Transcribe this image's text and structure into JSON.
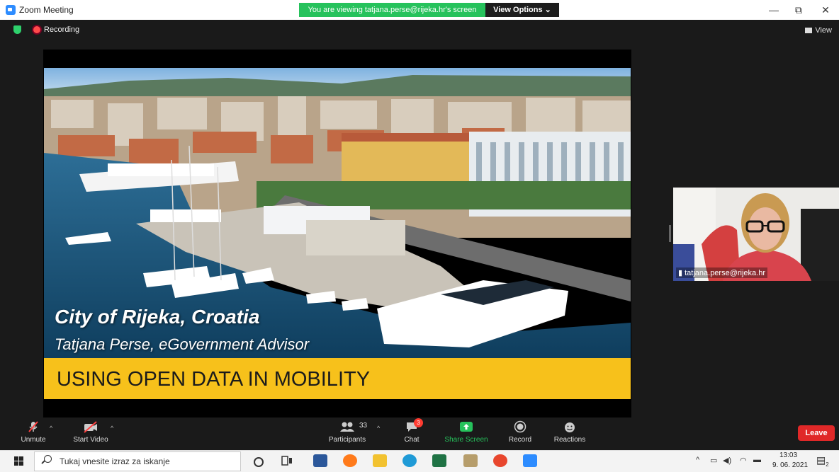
{
  "window": {
    "title": "Zoom Meeting",
    "share_banner": "You are viewing tatjana.perse@rijeka.hr's screen",
    "view_options": "View Options",
    "minimize": "—",
    "restore": "⧉",
    "close": "✕"
  },
  "meeting": {
    "recording_label": "Recording",
    "view_label": "View"
  },
  "slide": {
    "title": "City of Rijeka, Croatia",
    "subtitle": "Tatjana Perse, eGovernment Advisor",
    "banner": "USING OPEN DATA IN MOBILITY",
    "banner_color": "#f7c11b"
  },
  "video": {
    "participant_name": "tatjana.perse@rijeka.hr"
  },
  "controls": {
    "unmute": "Unmute",
    "start_video": "Start Video",
    "participants": "Participants",
    "participants_count": "33",
    "chat": "Chat",
    "chat_badge": "3",
    "share_screen": "Share Screen",
    "record": "Record",
    "reactions": "Reactions",
    "leave": "Leave",
    "leave_color": "#e02828",
    "share_color": "#26c25c"
  },
  "taskbar": {
    "search_placeholder": "Tukaj vnesite izraz za iskanje",
    "time": "13:03",
    "date": "9. 06. 2021",
    "notifications": "2"
  }
}
